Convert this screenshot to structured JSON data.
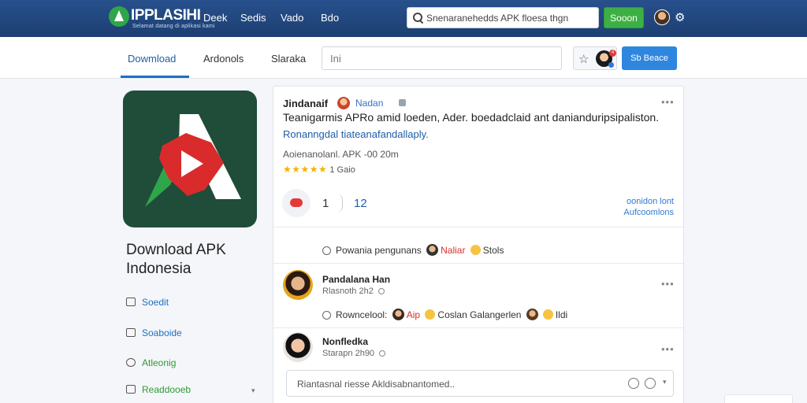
{
  "header": {
    "brand": "IPPLASIHI",
    "brand_sub": "Selamat datang di aplikasi kami",
    "nav": [
      "Deek",
      "Sedis",
      "Vado",
      "Bdo"
    ],
    "search_text": "Snenaranehedds APK floesa thgn",
    "search_button": "Sooon"
  },
  "subnav": {
    "tabs": [
      "Dowmload",
      "Ardonols",
      "Slaraka"
    ],
    "active_tab": "Dowmload",
    "input_value": "Ini",
    "notif_count": "4",
    "action_button": "Sb Beace"
  },
  "sidebar": {
    "app_title": "Download APK Indonesia",
    "links": [
      {
        "label": "Soedit",
        "icon": "chat-icon"
      },
      {
        "label": "Soaboide",
        "icon": "comment-icon"
      },
      {
        "label": "Atleonig",
        "icon": "search-icon"
      },
      {
        "label": "Readdooeb",
        "icon": "checkbox-icon"
      }
    ]
  },
  "post": {
    "author": "Jindanaif",
    "meta": "Nadan",
    "body": "Teanigarmis APRo amid loeden, Ader. boedadclaid ant danianduripsipaliston.",
    "sub": "Ronanngdal tiateanafandallaply.",
    "info": "Aoienanolanl. APK -00 20m",
    "rating_stars": "★★★★★",
    "rating_count": "1",
    "rating_label": "Gaio",
    "react_count_1": "1",
    "react_count_2": "12",
    "action_1": "oonidon lont",
    "action_2": "Aufcoomlons"
  },
  "comments": {
    "summary": {
      "text": "Powania pengunans",
      "name": "Naliar",
      "tail": "Stols"
    },
    "items": [
      {
        "name": "Pandalana Han",
        "time": "Rlasnoth 2h2",
        "line_prefix": "Rowncelool:",
        "line_name": "Aip",
        "line_text": "Coslan Galangerlen",
        "line_tail": "Ildi"
      },
      {
        "name": "Nonfledka",
        "time": "Starapn 2h90"
      }
    ],
    "reply_placeholder": "Riantasnal riesse Akldisabnantomed.."
  },
  "colors": {
    "header_bg": "#27508c",
    "accent_blue": "#1f6fc4",
    "accent_green": "#3cb043",
    "star": "#f4b400",
    "reaction_red": "#e53935"
  }
}
